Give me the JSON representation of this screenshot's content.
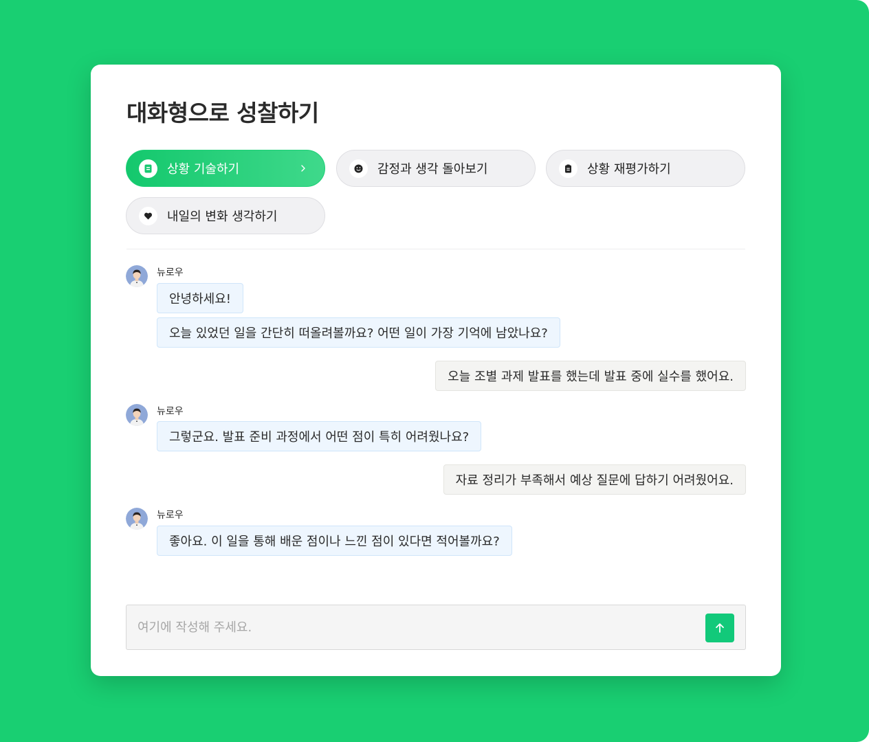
{
  "page": {
    "title": "대화형으로 성찰하기"
  },
  "steps": [
    {
      "label": "상황 기술하기",
      "icon": "document-icon",
      "active": true
    },
    {
      "label": "감정과 생각 돌아보기",
      "icon": "smiley-icon",
      "active": false
    },
    {
      "label": "상황 재평가하기",
      "icon": "clipboard-icon",
      "active": false
    },
    {
      "label": "내일의 변화 생각하기",
      "icon": "heart-icon",
      "active": false
    }
  ],
  "chat": {
    "bot_name": "뉴로우",
    "messages": [
      {
        "from": "bot",
        "text": "안녕하세요!"
      },
      {
        "from": "bot",
        "text": "오늘 있었던 일을 간단히 떠올려볼까요? 어떤 일이 가장 기억에 남았나요?"
      },
      {
        "from": "user",
        "text": "오늘 조별 과제 발표를 했는데 발표 중에 실수를 했어요."
      },
      {
        "from": "bot",
        "text": "그렇군요. 발표 준비 과정에서 어떤 점이 특히 어려웠나요?"
      },
      {
        "from": "user",
        "text": "자료 정리가 부족해서 예상 질문에 답하기 어려웠어요."
      },
      {
        "from": "bot",
        "text": "좋아요. 이 일을 통해 배운 점이나 느낀 점이 있다면 적어볼까요?"
      }
    ]
  },
  "composer": {
    "placeholder": "여기에 작성해 주세요.",
    "value": "",
    "send_icon": "arrow-up-icon"
  },
  "colors": {
    "background": "#19cf72",
    "accent": "#14c86d",
    "send_button": "#12c97a",
    "bot_bubble": "#eef6fe",
    "user_bubble": "#f4f4f2"
  }
}
